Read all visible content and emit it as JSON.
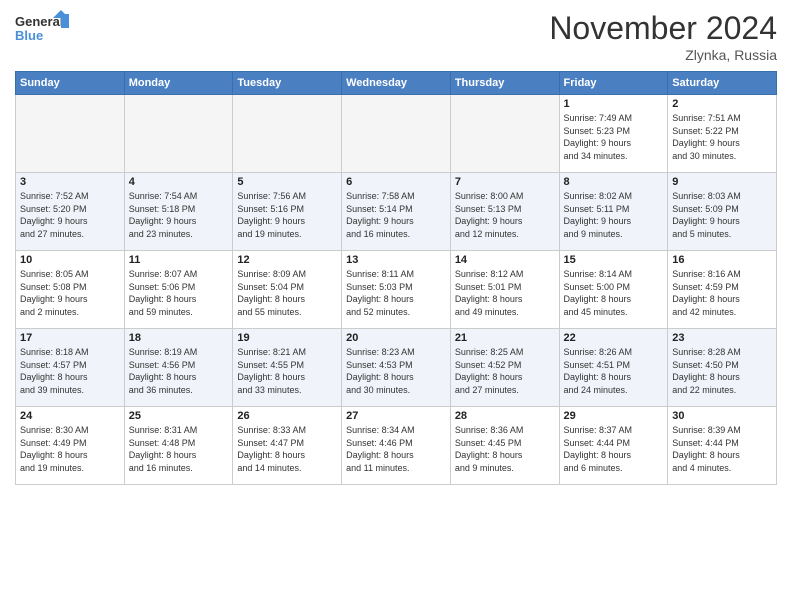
{
  "header": {
    "logo_line1": "General",
    "logo_line2": "Blue",
    "month": "November 2024",
    "location": "Zlynka, Russia"
  },
  "weekdays": [
    "Sunday",
    "Monday",
    "Tuesday",
    "Wednesday",
    "Thursday",
    "Friday",
    "Saturday"
  ],
  "weeks": [
    [
      {
        "day": "",
        "info": ""
      },
      {
        "day": "",
        "info": ""
      },
      {
        "day": "",
        "info": ""
      },
      {
        "day": "",
        "info": ""
      },
      {
        "day": "",
        "info": ""
      },
      {
        "day": "1",
        "info": "Sunrise: 7:49 AM\nSunset: 5:23 PM\nDaylight: 9 hours\nand 34 minutes."
      },
      {
        "day": "2",
        "info": "Sunrise: 7:51 AM\nSunset: 5:22 PM\nDaylight: 9 hours\nand 30 minutes."
      }
    ],
    [
      {
        "day": "3",
        "info": "Sunrise: 7:52 AM\nSunset: 5:20 PM\nDaylight: 9 hours\nand 27 minutes."
      },
      {
        "day": "4",
        "info": "Sunrise: 7:54 AM\nSunset: 5:18 PM\nDaylight: 9 hours\nand 23 minutes."
      },
      {
        "day": "5",
        "info": "Sunrise: 7:56 AM\nSunset: 5:16 PM\nDaylight: 9 hours\nand 19 minutes."
      },
      {
        "day": "6",
        "info": "Sunrise: 7:58 AM\nSunset: 5:14 PM\nDaylight: 9 hours\nand 16 minutes."
      },
      {
        "day": "7",
        "info": "Sunrise: 8:00 AM\nSunset: 5:13 PM\nDaylight: 9 hours\nand 12 minutes."
      },
      {
        "day": "8",
        "info": "Sunrise: 8:02 AM\nSunset: 5:11 PM\nDaylight: 9 hours\nand 9 minutes."
      },
      {
        "day": "9",
        "info": "Sunrise: 8:03 AM\nSunset: 5:09 PM\nDaylight: 9 hours\nand 5 minutes."
      }
    ],
    [
      {
        "day": "10",
        "info": "Sunrise: 8:05 AM\nSunset: 5:08 PM\nDaylight: 9 hours\nand 2 minutes."
      },
      {
        "day": "11",
        "info": "Sunrise: 8:07 AM\nSunset: 5:06 PM\nDaylight: 8 hours\nand 59 minutes."
      },
      {
        "day": "12",
        "info": "Sunrise: 8:09 AM\nSunset: 5:04 PM\nDaylight: 8 hours\nand 55 minutes."
      },
      {
        "day": "13",
        "info": "Sunrise: 8:11 AM\nSunset: 5:03 PM\nDaylight: 8 hours\nand 52 minutes."
      },
      {
        "day": "14",
        "info": "Sunrise: 8:12 AM\nSunset: 5:01 PM\nDaylight: 8 hours\nand 49 minutes."
      },
      {
        "day": "15",
        "info": "Sunrise: 8:14 AM\nSunset: 5:00 PM\nDaylight: 8 hours\nand 45 minutes."
      },
      {
        "day": "16",
        "info": "Sunrise: 8:16 AM\nSunset: 4:59 PM\nDaylight: 8 hours\nand 42 minutes."
      }
    ],
    [
      {
        "day": "17",
        "info": "Sunrise: 8:18 AM\nSunset: 4:57 PM\nDaylight: 8 hours\nand 39 minutes."
      },
      {
        "day": "18",
        "info": "Sunrise: 8:19 AM\nSunset: 4:56 PM\nDaylight: 8 hours\nand 36 minutes."
      },
      {
        "day": "19",
        "info": "Sunrise: 8:21 AM\nSunset: 4:55 PM\nDaylight: 8 hours\nand 33 minutes."
      },
      {
        "day": "20",
        "info": "Sunrise: 8:23 AM\nSunset: 4:53 PM\nDaylight: 8 hours\nand 30 minutes."
      },
      {
        "day": "21",
        "info": "Sunrise: 8:25 AM\nSunset: 4:52 PM\nDaylight: 8 hours\nand 27 minutes."
      },
      {
        "day": "22",
        "info": "Sunrise: 8:26 AM\nSunset: 4:51 PM\nDaylight: 8 hours\nand 24 minutes."
      },
      {
        "day": "23",
        "info": "Sunrise: 8:28 AM\nSunset: 4:50 PM\nDaylight: 8 hours\nand 22 minutes."
      }
    ],
    [
      {
        "day": "24",
        "info": "Sunrise: 8:30 AM\nSunset: 4:49 PM\nDaylight: 8 hours\nand 19 minutes."
      },
      {
        "day": "25",
        "info": "Sunrise: 8:31 AM\nSunset: 4:48 PM\nDaylight: 8 hours\nand 16 minutes."
      },
      {
        "day": "26",
        "info": "Sunrise: 8:33 AM\nSunset: 4:47 PM\nDaylight: 8 hours\nand 14 minutes."
      },
      {
        "day": "27",
        "info": "Sunrise: 8:34 AM\nSunset: 4:46 PM\nDaylight: 8 hours\nand 11 minutes."
      },
      {
        "day": "28",
        "info": "Sunrise: 8:36 AM\nSunset: 4:45 PM\nDaylight: 8 hours\nand 9 minutes."
      },
      {
        "day": "29",
        "info": "Sunrise: 8:37 AM\nSunset: 4:44 PM\nDaylight: 8 hours\nand 6 minutes."
      },
      {
        "day": "30",
        "info": "Sunrise: 8:39 AM\nSunset: 4:44 PM\nDaylight: 8 hours\nand 4 minutes."
      }
    ]
  ]
}
